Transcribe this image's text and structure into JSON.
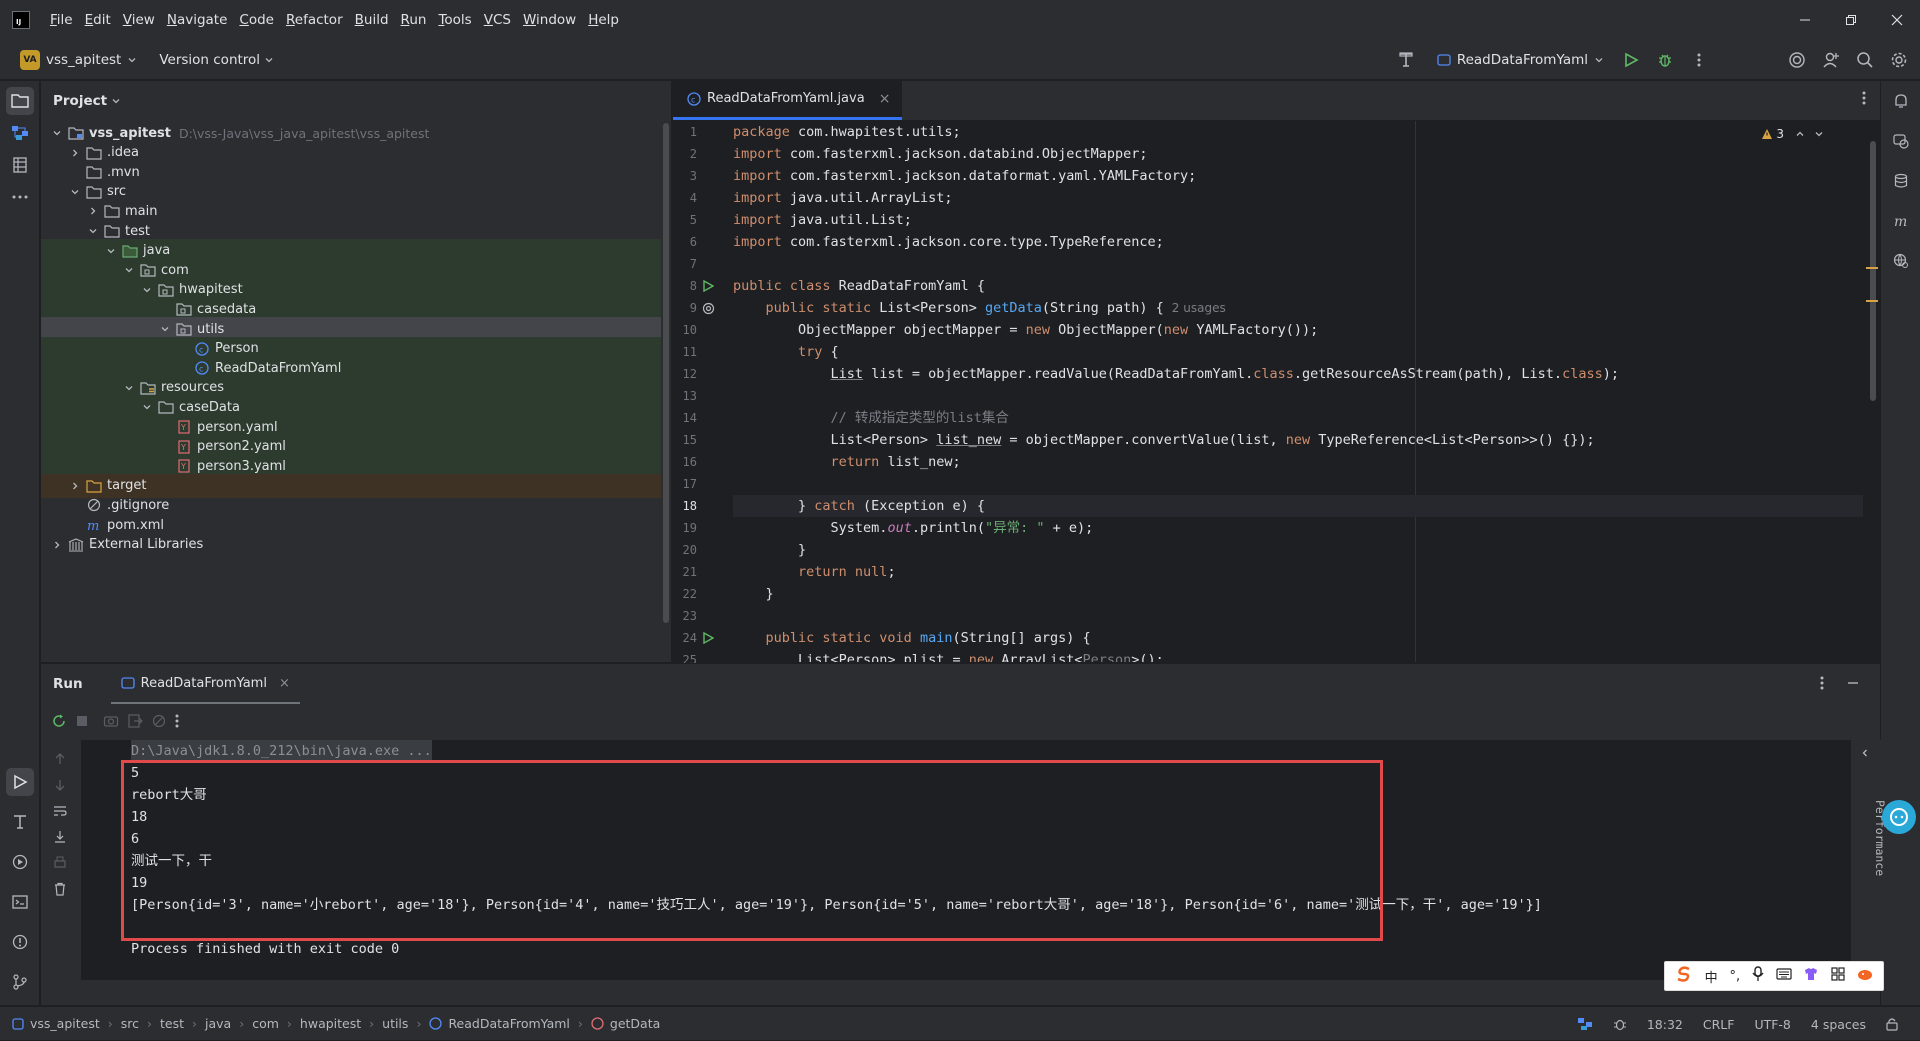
{
  "window": {
    "menus": [
      "File",
      "Edit",
      "View",
      "Navigate",
      "Code",
      "Refactor",
      "Build",
      "Run",
      "Tools",
      "VCS",
      "Window",
      "Help"
    ]
  },
  "toolbar": {
    "project_badge": "VA",
    "project_name": "vss_apitest",
    "vcs_label": "Version control",
    "run_config": "ReadDataFromYaml"
  },
  "project": {
    "title": "Project",
    "tree": [
      {
        "label": "vss_apitest",
        "path": "D:\\vss-Java\\vss_java_apitest\\vss_apitest",
        "icon": "module-folder-icon",
        "expanded": true
      },
      {
        "label": ".idea",
        "icon": "folder-icon",
        "expanded": false
      },
      {
        "label": ".mvn",
        "icon": "folder-icon"
      },
      {
        "label": "src",
        "icon": "folder-icon",
        "expanded": true
      },
      {
        "label": "main",
        "icon": "folder-icon",
        "expanded": false
      },
      {
        "label": "test",
        "icon": "folder-icon",
        "expanded": true
      },
      {
        "label": "java",
        "icon": "test-source-folder-icon",
        "expanded": true
      },
      {
        "label": "com",
        "icon": "package-icon",
        "expanded": true
      },
      {
        "label": "hwapitest",
        "icon": "package-icon",
        "expanded": true
      },
      {
        "label": "casedata",
        "icon": "package-icon"
      },
      {
        "label": "utils",
        "icon": "package-icon",
        "expanded": true
      },
      {
        "label": "Person",
        "icon": "java-class-icon"
      },
      {
        "label": "ReadDataFromYaml",
        "icon": "java-class-icon"
      },
      {
        "label": "resources",
        "icon": "resources-folder-icon",
        "expanded": true
      },
      {
        "label": "caseData",
        "icon": "folder-icon",
        "expanded": true
      },
      {
        "label": "person.yaml",
        "icon": "yaml-file-icon"
      },
      {
        "label": "person2.yaml",
        "icon": "yaml-file-icon"
      },
      {
        "label": "person3.yaml",
        "icon": "yaml-file-icon"
      },
      {
        "label": "target",
        "icon": "excluded-folder-icon",
        "expanded": false
      },
      {
        "label": ".gitignore",
        "icon": "gitignore-icon"
      },
      {
        "label": "pom.xml",
        "icon": "maven-icon"
      },
      {
        "label": "External Libraries",
        "icon": "library-icon",
        "expanded": false
      }
    ]
  },
  "editor": {
    "tab_label": "ReadDataFromYaml.java",
    "warnings": "3",
    "usage_hint": "2 usages",
    "line_numbers": [
      "1",
      "2",
      "3",
      "4",
      "5",
      "6",
      "7",
      "8",
      "9",
      "10",
      "11",
      "12",
      "13",
      "14",
      "15",
      "16",
      "17",
      "18",
      "19",
      "20",
      "21",
      "22",
      "23",
      "24",
      "25"
    ],
    "code": {
      "l1a": "package",
      "l1b": " com.hwapitest.utils;",
      "l2a": "import",
      "l2b": " com.fasterxml.jackson.databind.ObjectMapper;",
      "l3a": "import",
      "l3b": " com.fasterxml.jackson.dataformat.yaml.YAMLFactory;",
      "l4a": "import",
      "l4b": " java.util.ArrayList;",
      "l5a": "import",
      "l5b": " java.util.List;",
      "l6a": "import",
      "l6b": " com.fasterxml.jackson.core.type.TypeReference;",
      "l8a": "public class",
      "l8b": " ReadDataFromYaml {",
      "l9a": "    public static",
      "l9b": " List<Person> ",
      "l9c": "getData",
      "l9d": "(String path) {",
      "l10a": "        ObjectMapper objectMapper = ",
      "l10b": "new",
      "l10c": " ObjectMapper(",
      "l10d": "new",
      "l10e": " YAMLFactory());",
      "l11a": "        ",
      "l11b": "try",
      "l11c": " {",
      "l12a": "            ",
      "l12b": "List",
      "l12c": " list = objectMapper.readValue(ReadDataFromYaml.",
      "l12d": "class",
      "l12e": ".getResourceAsStream(path), List.",
      "l12f": "class",
      "l12g": ");",
      "l14": "            // 转成指定类型的list集合",
      "l15a": "            List<Person> ",
      "l15b": "list_new",
      "l15c": " = objectMapper.convertValue(list, ",
      "l15d": "new",
      "l15e": " TypeReference<List<Person>>() {});",
      "l16a": "            ",
      "l16b": "return",
      "l16c": " list_new;",
      "l18a": "        } ",
      "l18b": "catch",
      "l18c": " (Exception e) {",
      "l19a": "            System.",
      "l19b": "out",
      "l19c": ".println(",
      "l19d": "\"异常: \"",
      "l19e": " + e);",
      "l20": "        }",
      "l21a": "        ",
      "l21b": "return null",
      "l21c": ";",
      "l22": "    }",
      "l24a": "    public static void ",
      "l24b": "main",
      "l24c": "(String[] args) {",
      "l25a": "        List<Person> plist = ",
      "l25b": "new",
      "l25c": " ArrayList<",
      "l25d": "Person",
      "l25e": ">();"
    }
  },
  "run": {
    "title": "Run",
    "tab_label": "ReadDataFromYaml",
    "performance_label": "Performance",
    "console": [
      "D:\\Java\\jdk1.8.0_212\\bin\\java.exe ...",
      "5",
      "rebort大哥",
      "18",
      "6",
      "测试一下，干",
      "19",
      "[Person{id='3', name='小rebort', age='18'}, Person{id='4', name='技巧工人', age='19'}, Person{id='5', name='rebort大哥', age='18'}, Person{id='6', name='测试一下，干', age='19'}]",
      "",
      "Process finished with exit code 0"
    ]
  },
  "ime": {
    "chinese": "中",
    "punct": "°,"
  },
  "status": {
    "breadcrumbs": [
      "vss_apitest",
      "src",
      "test",
      "java",
      "com",
      "hwapitest",
      "utils",
      "ReadDataFromYaml",
      "getData"
    ],
    "position": "18:32",
    "line_sep": "CRLF",
    "encoding": "UTF-8",
    "indent": "4 spaces"
  },
  "colors": {
    "accent": "#3574f0",
    "run_green": "#5fb865",
    "highlight_box": "#e04a4a",
    "warning": "#d9a343"
  }
}
